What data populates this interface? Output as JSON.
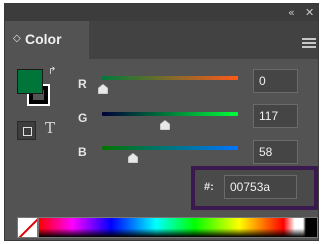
{
  "header": {
    "collapse_icon": "«",
    "close_icon": "✕"
  },
  "panel": {
    "chevron_icon": "◇",
    "title": "Color",
    "menu_icon": "hamburger-menu"
  },
  "colors": {
    "fill": "#00753a",
    "stroke": "#000000",
    "panel_bg": "#535353",
    "highlight_frame": "#3a1a4e"
  },
  "swap_icon": "↱",
  "text_mode_label": "T",
  "channels": [
    {
      "label": "R",
      "value": "0"
    },
    {
      "label": "G",
      "value": "117"
    },
    {
      "label": "B",
      "value": "58"
    }
  ],
  "hex": {
    "label": "#:",
    "value": "00753a"
  }
}
